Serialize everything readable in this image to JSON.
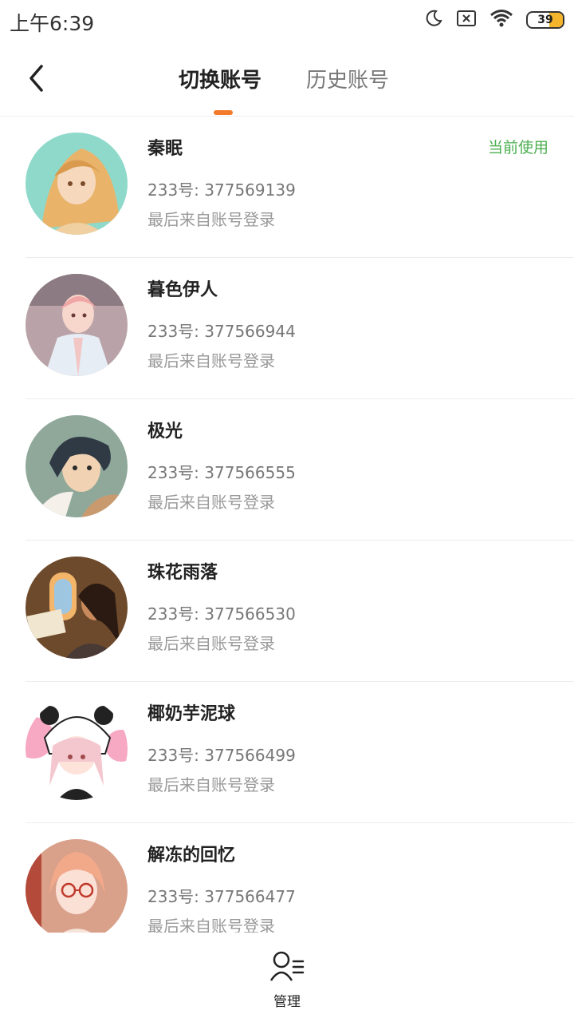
{
  "status_bar": {
    "time": "上午6:39",
    "icons": [
      "moon-icon",
      "sim-off-icon",
      "wifi-icon",
      "battery-icon"
    ],
    "battery_level": "39",
    "battery_fraction": 0.39
  },
  "header": {
    "back_icon": "chevron-left-icon",
    "tabs": [
      {
        "label": "切换账号",
        "active": true
      },
      {
        "label": "历史账号",
        "active": false
      }
    ],
    "accent_color": "#f27a2a"
  },
  "accounts": [
    {
      "name": "秦眠",
      "id": "233号: 377569139",
      "login": "最后来自账号登录",
      "current": "当前使用"
    },
    {
      "name": "暮色伊人",
      "id": "233号: 377566944",
      "login": "最后来自账号登录"
    },
    {
      "name": "极光",
      "id": "233号: 377566555",
      "login": "最后来自账号登录"
    },
    {
      "name": "珠花雨落",
      "id": "233号: 377566530",
      "login": "最后来自账号登录"
    },
    {
      "name": "椰奶芋泥球",
      "id": "233号: 377566499",
      "login": "最后来自账号登录"
    },
    {
      "name": "解冻的回忆",
      "id": "233号: 377566477",
      "login": "最后来自账号登录"
    }
  ],
  "current_color": "#4caf50",
  "bottom_bar": {
    "manage_label": "管理",
    "manage_icon": "user-manage-icon"
  }
}
